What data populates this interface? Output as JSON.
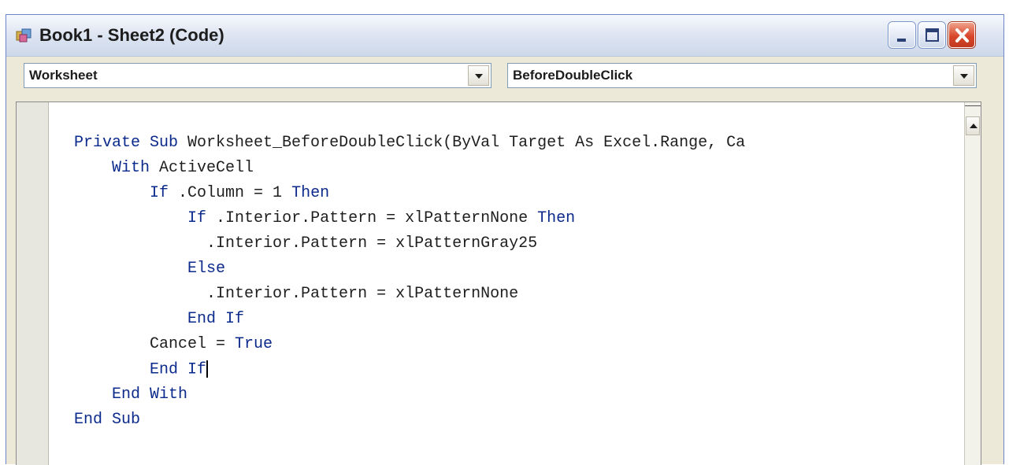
{
  "window": {
    "title": "Book1 - Sheet2 (Code)"
  },
  "combos": {
    "object": "Worksheet",
    "procedure": "BeforeDoubleClick"
  },
  "code": {
    "lines": [
      {
        "indent": "",
        "keyword": "Private Sub",
        "rest": " Worksheet_BeforeDoubleClick(ByVal Target As Excel.Range, Ca",
        "after": ""
      },
      {
        "indent": "    ",
        "keyword": "With",
        "rest": " ActiveCell",
        "after": ""
      },
      {
        "indent": "        ",
        "keyword": "If",
        "rest": " .Column = 1 ",
        "after": "Then"
      },
      {
        "indent": "            ",
        "keyword": "If",
        "rest": " .Interior.Pattern = xlPatternNone ",
        "after": "Then"
      },
      {
        "indent": "              ",
        "keyword": "",
        "rest": ".Interior.Pattern = xlPatternGray25",
        "after": ""
      },
      {
        "indent": "            ",
        "keyword": "Else",
        "rest": "",
        "after": ""
      },
      {
        "indent": "              ",
        "keyword": "",
        "rest": ".Interior.Pattern = xlPatternNone",
        "after": ""
      },
      {
        "indent": "            ",
        "keyword": "End If",
        "rest": "",
        "after": ""
      },
      {
        "indent": "        ",
        "keyword": "",
        "rest": "Cancel = ",
        "after": "True"
      },
      {
        "indent": "        ",
        "keyword": "End If",
        "rest": "",
        "after": ""
      },
      {
        "indent": "    ",
        "keyword": "End With",
        "rest": "",
        "after": ""
      },
      {
        "indent": "",
        "keyword": "End Sub",
        "rest": "",
        "after": ""
      }
    ]
  },
  "colors": {
    "keyword": "#0b2a8c",
    "text": "#1e1e1e",
    "title_bar": "#dfe6f2",
    "close_button": "#d9472b"
  },
  "icons": [
    "vba-project-icon",
    "minimize-icon",
    "maximize-icon",
    "close-icon",
    "dropdown-arrow-icon",
    "scroll-up-icon"
  ]
}
